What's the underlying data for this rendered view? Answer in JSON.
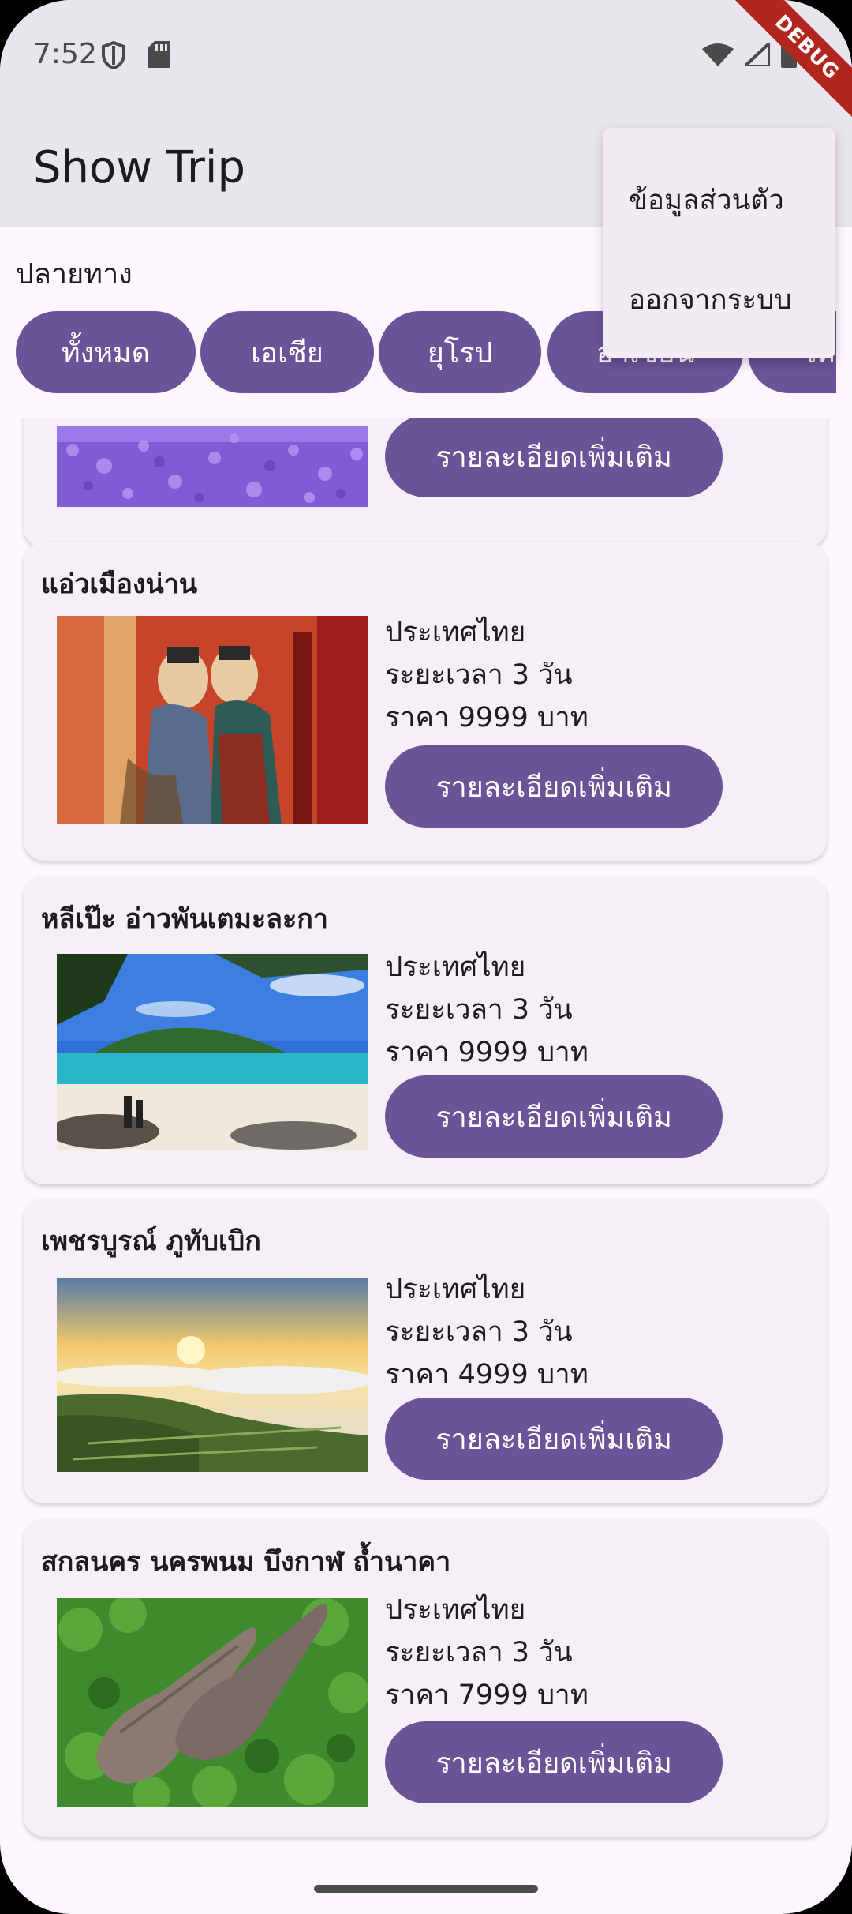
{
  "status_bar": {
    "time": "7:52"
  },
  "app_bar": {
    "title": "Show Trip",
    "debug_label": "DEBUG"
  },
  "filter": {
    "label": "ปลายทาง",
    "chips": [
      "ทั้งหมด",
      "เอเชีย",
      "ยุโรป",
      "อาเซียน",
      "ไทย"
    ]
  },
  "popup_menu": {
    "items": [
      "ข้อมูลส่วนตัว",
      "ออกจากระบบ"
    ]
  },
  "trips": [
    {
      "name": "",
      "country": "",
      "duration": "",
      "price": "",
      "button": "รายละเอียดเพิ่มเติม"
    },
    {
      "name": "แอ่วเมืองน่าน",
      "country": "ประเทศไทย",
      "duration": "ระยะเวลา 3 วัน",
      "price": "ราคา 9999 บาท",
      "button": "รายละเอียดเพิ่มเติม"
    },
    {
      "name": "หลีเป๊ะ อ่าวพันเตมะละกา",
      "country": "ประเทศไทย",
      "duration": "ระยะเวลา 3 วัน",
      "price": "ราคา 9999 บาท",
      "button": "รายละเอียดเพิ่มเติม"
    },
    {
      "name": "เพชรบูรณ์ ภูทับเบิก",
      "country": "ประเทศไทย",
      "duration": "ระยะเวลา 3 วัน",
      "price": "ราคา 4999 บาท",
      "button": "รายละเอียดเพิ่มเติม"
    },
    {
      "name": "สกลนคร นครพนม บึงกาฬ ถ้ำนาคา",
      "country": "ประเทศไทย",
      "duration": "ระยะเวลา 3 วัน",
      "price": "ราคา 7999 บาท",
      "button": "รายละเอียดเพิ่มเติม"
    }
  ],
  "colors": {
    "primary": "#6a5497",
    "app_bar": "#e9e5ed",
    "background": "#fef7ff",
    "card": "#f5eff7"
  }
}
